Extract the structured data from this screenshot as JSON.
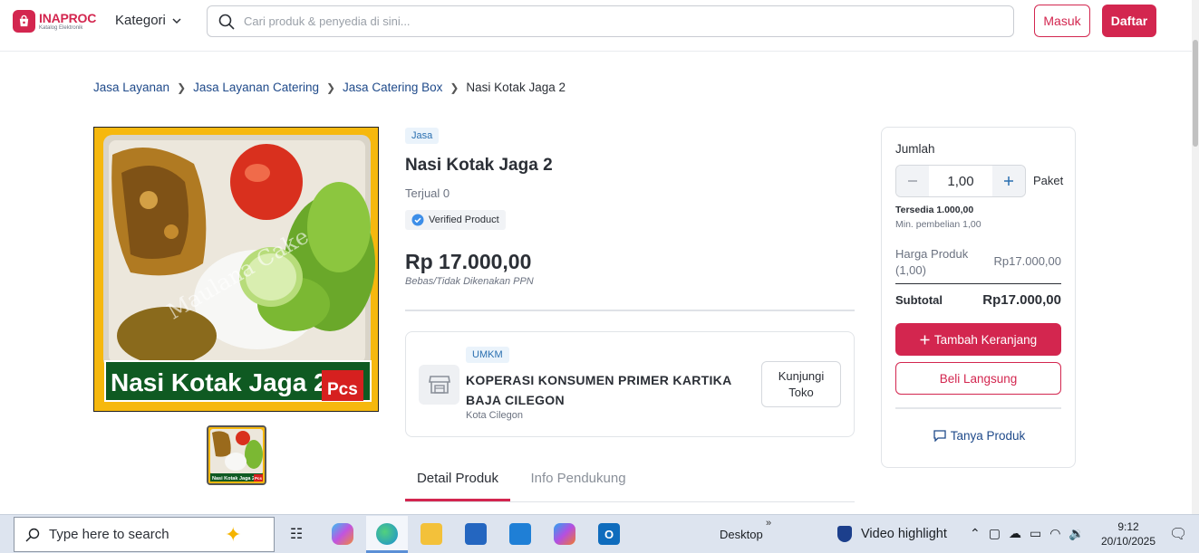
{
  "header": {
    "logo_main": "INAPROC",
    "logo_sub": "Katalog Elektronik",
    "kategori_label": "Kategori",
    "search_placeholder": "Cari produk & penyedia di sini...",
    "masuk_label": "Masuk",
    "daftar_label": "Daftar"
  },
  "breadcrumb": {
    "items": [
      "Jasa Layanan",
      "Jasa Layanan Catering",
      "Jasa Catering Box"
    ],
    "current": "Nasi Kotak Jaga 2"
  },
  "product": {
    "image_caption": "Nasi Kotak Jaga 2",
    "image_badge": "Pcs",
    "image_watermark": "Maulana Cake",
    "thumb_caption": "Nasi Kotak Jaga 2",
    "thumb_badge": "Pcs",
    "category_tag": "Jasa",
    "title": "Nasi Kotak Jaga 2",
    "sold": "Terjual 0",
    "verified": "Verified Product",
    "price": "Rp 17.000,00",
    "tax_note": "Bebas/Tidak Dikenakan PPN"
  },
  "store": {
    "tag": "UMKM",
    "name": "KOPERASI KONSUMEN PRIMER KARTIKA BAJA CILEGON",
    "city": "Kota Cilegon",
    "visit_line1": "Kunjungi",
    "visit_line2": "Toko"
  },
  "tabs": [
    {
      "label": "Detail Produk",
      "active": true
    },
    {
      "label": "Info Pendukung",
      "active": false
    }
  ],
  "purchase": {
    "quantity_label": "Jumlah",
    "quantity_value": "1,00",
    "unit": "Paket",
    "stock": "Tersedia 1.000,00",
    "min_purchase": "Min. pembelian 1,00",
    "price_label_line1": "Harga Produk",
    "price_label_line2": "(1,00)",
    "price_value": "Rp17.000,00",
    "subtotal_label": "Subtotal",
    "subtotal_value": "Rp17.000,00",
    "add_cart_label": "Tambah Keranjang",
    "buy_now_label": "Beli Langsung",
    "ask_label": "Tanya Produk"
  },
  "taskbar": {
    "search_text": "Type here to search",
    "desktop_label": "Desktop",
    "chevron": "»",
    "video_label": "Video highlight",
    "time": "9:12",
    "date": "20/10/2025"
  },
  "colors": {
    "brand": "#d3264f",
    "link": "#1f4a8a",
    "tag_bg": "#eaf3fb"
  }
}
